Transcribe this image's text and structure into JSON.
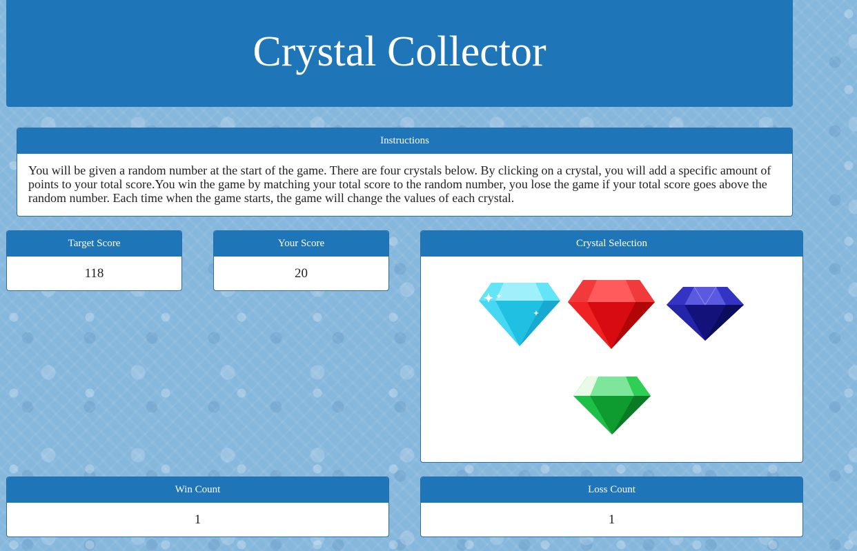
{
  "header": {
    "title": "Crystal Collector"
  },
  "instructions": {
    "heading": "Instructions",
    "text": "You will be given a random number at the start of the game. There are four crystals below. By clicking on a crystal, you will add a specific amount of points to your total score.You win the game by matching your total score to the random number, you lose the game if your total score goes above the random number. Each time when the game starts, the game will change the values of each crystal."
  },
  "target": {
    "heading": "Target Score",
    "value": "118"
  },
  "score": {
    "heading": "Your Score",
    "value": "20"
  },
  "crystal_selection": {
    "heading": "Crystal Selection",
    "crystals": [
      {
        "icon": "cyan-crystal-icon",
        "color": "#33d4f0"
      },
      {
        "icon": "red-crystal-icon",
        "color": "#e8181a"
      },
      {
        "icon": "blue-crystal-icon",
        "color": "#1a1a9e"
      },
      {
        "icon": "green-crystal-icon",
        "color": "#14b43c"
      }
    ]
  },
  "wins": {
    "heading": "Win Count",
    "value": "1"
  },
  "losses": {
    "heading": "Loss Count",
    "value": "1"
  },
  "colors": {
    "panel_header": "#1e76b8",
    "background": "#86b7dc"
  }
}
